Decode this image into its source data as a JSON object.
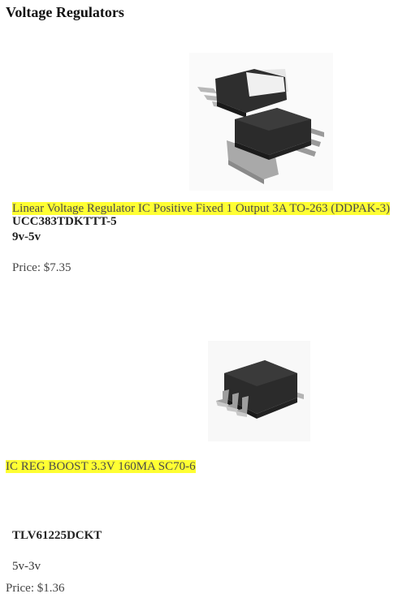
{
  "page": {
    "title": "Voltage Regulators"
  },
  "products": [
    {
      "image_icon": "ddpak-to263-package-icon",
      "name": "Linear Voltage Regulator IC Positive Fixed 1 Output 3A TO-263 (DDPAK-3)",
      "part_number": "UCC383TDKTTT-5",
      "voltage": "9v-5v",
      "price_label": "Price:",
      "price_value": "$7.35"
    },
    {
      "image_icon": "sc70-6-package-icon",
      "name": "IC REG BOOST 3.3V 160MA SC70-6",
      "part_number": "TLV61225DCKT",
      "voltage": "5v-3v",
      "price_label": "Price:",
      "price_value": "$1.36"
    }
  ],
  "colors": {
    "highlight": "#ffff33",
    "chip_body": "#2b2b2b",
    "chip_lead": "#9a9a9a"
  }
}
